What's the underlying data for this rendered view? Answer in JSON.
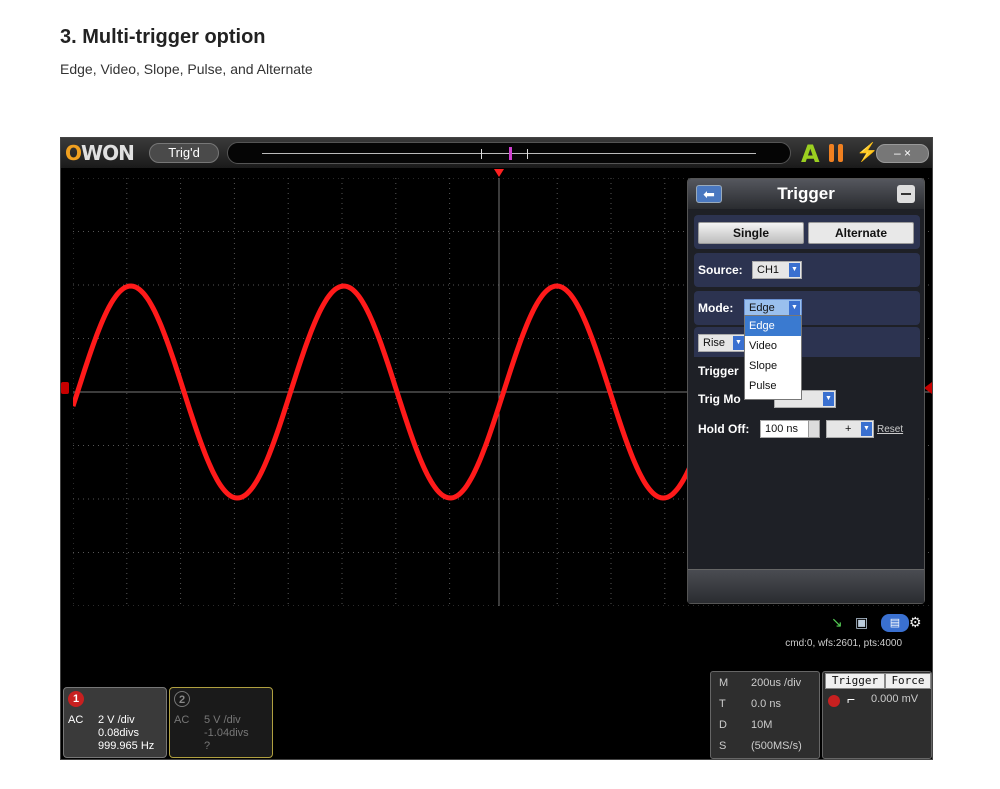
{
  "page": {
    "heading": "3. Multi-trigger option",
    "subheading": "Edge, Video, Slope, Pulse, and Alternate"
  },
  "scope": {
    "logo": "OWON",
    "status": "Trig'd",
    "trigger_panel": {
      "title": "Trigger",
      "tabs": [
        {
          "label": "Single",
          "active": true
        },
        {
          "label": "Alternate",
          "active": false
        }
      ],
      "source_label": "Source:",
      "source_value": "CH1",
      "mode_label": "Mode:",
      "mode_value": "Edge",
      "mode_options": [
        "Edge",
        "Video",
        "Slope",
        "Pulse"
      ],
      "slope_value": "Rise",
      "trigger_label": "Trigger",
      "trig_mode_label": "Trig Mo",
      "holdoff_label": "Hold Off:",
      "holdoff_value": "100 ns",
      "holdoff_step": "+",
      "reset_label": "Reset"
    },
    "status_line": "cmd:0, wfs:2601, pts:4000",
    "ch1": {
      "num": "1",
      "coupling": "AC",
      "scale": "2 V /div",
      "offset": "0.08divs",
      "freq": "999.965 Hz"
    },
    "ch2": {
      "num": "2",
      "coupling": "AC",
      "scale": "5 V /div",
      "offset": "-1.04divs",
      "freq": "?"
    },
    "timebase": [
      {
        "key": "M",
        "value": "200us /div"
      },
      {
        "key": "T",
        "value": "0.0 ns"
      },
      {
        "key": "D",
        "value": "10M"
      },
      {
        "key": "S",
        "value": "(500MS/s)"
      }
    ],
    "trigger_info": {
      "trigger_btn": "Trigger",
      "force_btn": "Force",
      "level": "0.000 mV"
    },
    "colors": {
      "trace": "#ff1a1a",
      "ch2_border": "#b0a040",
      "accent_blue": "#3a70d0"
    }
  }
}
